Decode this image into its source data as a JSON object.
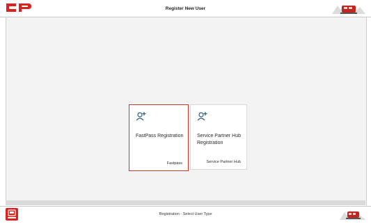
{
  "header": {
    "logo_text": "CP",
    "title": "Register New User"
  },
  "tiles": [
    {
      "name": "FastPass Registration",
      "tag": "Fastpass",
      "selected": true
    },
    {
      "name": "Service Partner Hub Registration",
      "tag": "Service Partner Hub",
      "selected": false
    }
  ],
  "footer": {
    "status_text": "Registration - Select User Type"
  },
  "colors": {
    "brand_red": "#d9231f",
    "selection_border": "#c0392b",
    "icon_blue": "#2c5b7a"
  },
  "icons": [
    "add-user-icon",
    "train-icon",
    "cp-logo-icon"
  ]
}
